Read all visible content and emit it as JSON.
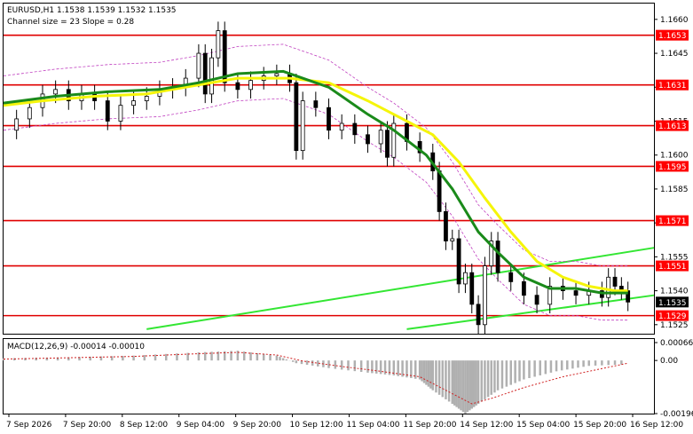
{
  "header": {
    "symbol_line": "EURUSD,H1  1.1538 1.1539 1.1532 1.1535",
    "channel_line": "Channel size = 23 Slope = 0.28"
  },
  "macd": {
    "label": "MACD(12,26,9) -0.00014 -0.00010",
    "ticks": [
      {
        "label": "0.00066",
        "value": 0.00066
      },
      {
        "label": "0.00",
        "value": 0.0
      },
      {
        "label": "-0.00196",
        "value": -0.00196
      }
    ]
  },
  "colors": {
    "level_line": "#e00000",
    "ma_fast": "#1a8a1a",
    "ma_slow": "#f5f50a",
    "channel": "#33e633",
    "bollinger": "#c040c0",
    "candle": "#000000",
    "price_tag": "#ff0000",
    "current_tag": "#000000"
  },
  "chart_data": {
    "type": "line",
    "series": [
      {
        "name": "EURUSD,H1",
        "values": []
      }
    ],
    "ylim": [
      1.1521,
      1.1667
    ],
    "x_ticks": [
      "7 Sep 2026",
      "7 Sep 20:00",
      "8 Sep 12:00",
      "9 Sep 04:00",
      "9 Sep 20:00",
      "10 Sep 12:00",
      "11 Sep 04:00",
      "11 Sep 20:00",
      "14 Sep 12:00",
      "15 Sep 04:00",
      "15 Sep 20:00",
      "16 Sep 12:00"
    ],
    "y_ticks": [
      {
        "label": "1.1660",
        "value": 1.166
      },
      {
        "label": "1.1645",
        "value": 1.1645
      },
      {
        "label": "1.1630",
        "value": 1.163
      },
      {
        "label": "1.1615",
        "value": 1.1615
      },
      {
        "label": "1.1600",
        "value": 1.16
      },
      {
        "label": "1.1585",
        "value": 1.1585
      },
      {
        "label": "1.1570",
        "value": 1.157
      },
      {
        "label": "1.1555",
        "value": 1.1555
      },
      {
        "label": "1.1540",
        "value": 1.154
      },
      {
        "label": "1.1525",
        "value": 1.1525
      }
    ],
    "levels": [
      {
        "label": "1.1653",
        "value": 1.1653
      },
      {
        "label": "1.1631",
        "value": 1.1631
      },
      {
        "label": "1.1613",
        "value": 1.1613
      },
      {
        "label": "1.1595",
        "value": 1.1595
      },
      {
        "label": "1.1571",
        "value": 1.1571
      },
      {
        "label": "1.1551",
        "value": 1.1551
      },
      {
        "label": "1.1529",
        "value": 1.1529
      }
    ],
    "current": {
      "label": "1.1535",
      "value": 1.1535
    },
    "ohlc_last": {
      "open": 1.1538,
      "high": 1.1539,
      "low": 1.1532,
      "close": 1.1535
    },
    "close_path": [
      [
        0,
        1.1611
      ],
      [
        0.02,
        1.1616
      ],
      [
        0.04,
        1.1621
      ],
      [
        0.06,
        1.1627
      ],
      [
        0.08,
        1.1629
      ],
      [
        0.1,
        1.1624
      ],
      [
        0.12,
        1.1627
      ],
      [
        0.14,
        1.1624
      ],
      [
        0.16,
        1.1615
      ],
      [
        0.18,
        1.1622
      ],
      [
        0.2,
        1.1624
      ],
      [
        0.22,
        1.1626
      ],
      [
        0.24,
        1.1629
      ],
      [
        0.26,
        1.163
      ],
      [
        0.28,
        1.1634
      ],
      [
        0.3,
        1.1645
      ],
      [
        0.31,
        1.1627
      ],
      [
        0.32,
        1.1643
      ],
      [
        0.33,
        1.1655
      ],
      [
        0.34,
        1.1632
      ],
      [
        0.36,
        1.1629
      ],
      [
        0.38,
        1.1633
      ],
      [
        0.4,
        1.1635
      ],
      [
        0.42,
        1.1636
      ],
      [
        0.44,
        1.1632
      ],
      [
        0.45,
        1.1602
      ],
      [
        0.46,
        1.1624
      ],
      [
        0.48,
        1.1621
      ],
      [
        0.5,
        1.1611
      ],
      [
        0.52,
        1.1614
      ],
      [
        0.54,
        1.1609
      ],
      [
        0.56,
        1.1605
      ],
      [
        0.58,
        1.1611
      ],
      [
        0.59,
        1.1599
      ],
      [
        0.6,
        1.1614
      ],
      [
        0.62,
        1.1606
      ],
      [
        0.64,
        1.1601
      ],
      [
        0.66,
        1.1593
      ],
      [
        0.67,
        1.1575
      ],
      [
        0.68,
        1.1562
      ],
      [
        0.69,
        1.1563
      ],
      [
        0.7,
        1.1543
      ],
      [
        0.71,
        1.1548
      ],
      [
        0.72,
        1.1534
      ],
      [
        0.73,
        1.1525
      ],
      [
        0.74,
        1.1551
      ],
      [
        0.75,
        1.1562
      ],
      [
        0.76,
        1.1548
      ],
      [
        0.78,
        1.1544
      ],
      [
        0.8,
        1.1538
      ],
      [
        0.82,
        1.1534
      ],
      [
        0.84,
        1.1542
      ],
      [
        0.86,
        1.154
      ],
      [
        0.88,
        1.1538
      ],
      [
        0.9,
        1.154
      ],
      [
        0.92,
        1.1537
      ],
      [
        0.93,
        1.1546
      ],
      [
        0.94,
        1.1542
      ],
      [
        0.95,
        1.154
      ],
      [
        0.96,
        1.1535
      ]
    ],
    "ma_fast": [
      [
        0,
        1.1623
      ],
      [
        0.08,
        1.1626
      ],
      [
        0.16,
        1.1628
      ],
      [
        0.24,
        1.1629
      ],
      [
        0.3,
        1.1632
      ],
      [
        0.36,
        1.1636
      ],
      [
        0.43,
        1.1637
      ],
      [
        0.5,
        1.163
      ],
      [
        0.56,
        1.1618
      ],
      [
        0.6,
        1.1611
      ],
      [
        0.65,
        1.16
      ],
      [
        0.69,
        1.1585
      ],
      [
        0.73,
        1.1566
      ],
      [
        0.76,
        1.1557
      ],
      [
        0.8,
        1.1546
      ],
      [
        0.84,
        1.1541
      ],
      [
        0.88,
        1.1541
      ],
      [
        0.92,
        1.1539
      ],
      [
        0.96,
        1.1539
      ]
    ],
    "ma_slow": [
      [
        0,
        1.1622
      ],
      [
        0.06,
        1.1624
      ],
      [
        0.14,
        1.1626
      ],
      [
        0.22,
        1.1627
      ],
      [
        0.3,
        1.1631
      ],
      [
        0.36,
        1.1634
      ],
      [
        0.44,
        1.1634
      ],
      [
        0.5,
        1.1632
      ],
      [
        0.56,
        1.1624
      ],
      [
        0.62,
        1.1615
      ],
      [
        0.66,
        1.1609
      ],
      [
        0.7,
        1.1597
      ],
      [
        0.74,
        1.1581
      ],
      [
        0.78,
        1.1566
      ],
      [
        0.82,
        1.1553
      ],
      [
        0.86,
        1.1546
      ],
      [
        0.9,
        1.1542
      ],
      [
        0.94,
        1.154
      ],
      [
        0.96,
        1.154
      ]
    ],
    "channel_upper": [
      [
        0.22,
        1.1523
      ],
      [
        1.0,
        1.1559
      ]
    ],
    "channel_lower": [
      [
        0.62,
        1.1523
      ],
      [
        1.0,
        1.1538
      ]
    ],
    "macd_hist": [
      [
        0,
        8e-05
      ],
      [
        0.1,
        0.00012
      ],
      [
        0.2,
        0.00018
      ],
      [
        0.3,
        0.0003
      ],
      [
        0.36,
        0.00036
      ],
      [
        0.42,
        0.00018
      ],
      [
        0.45,
        -0.0001
      ],
      [
        0.5,
        -0.00028
      ],
      [
        0.56,
        -0.00045
      ],
      [
        0.6,
        -0.00055
      ],
      [
        0.64,
        -0.0007
      ],
      [
        0.66,
        -0.0011
      ],
      [
        0.69,
        -0.0016
      ],
      [
        0.71,
        -0.00196
      ],
      [
        0.73,
        -0.0016
      ],
      [
        0.76,
        -0.0011
      ],
      [
        0.8,
        -0.0007
      ],
      [
        0.85,
        -0.0004
      ],
      [
        0.9,
        -0.0002
      ],
      [
        0.96,
        -0.00014
      ]
    ],
    "macd_signal": [
      [
        0,
        5e-05
      ],
      [
        0.1,
        0.0001
      ],
      [
        0.2,
        0.00015
      ],
      [
        0.3,
        0.00025
      ],
      [
        0.36,
        0.0003
      ],
      [
        0.42,
        0.0002
      ],
      [
        0.46,
        -2e-05
      ],
      [
        0.52,
        -0.00022
      ],
      [
        0.58,
        -0.0004
      ],
      [
        0.64,
        -0.0006
      ],
      [
        0.68,
        -0.0011
      ],
      [
        0.72,
        -0.0016
      ],
      [
        0.75,
        -0.0014
      ],
      [
        0.8,
        -0.001
      ],
      [
        0.86,
        -0.0006
      ],
      [
        0.92,
        -0.0003
      ],
      [
        0.96,
        -0.0001
      ]
    ]
  }
}
